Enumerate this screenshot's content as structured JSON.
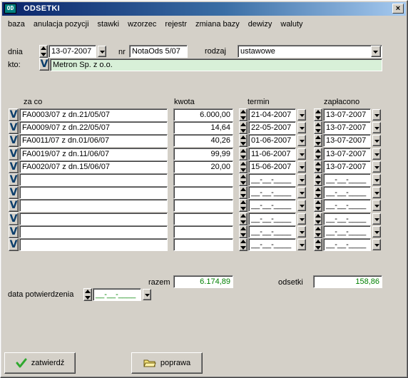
{
  "window": {
    "title": "ODSETKI",
    "icon_text": "OD"
  },
  "menu": [
    "baza",
    "anulacja pozycji",
    "stawki",
    "wzorzec",
    "rejestr",
    "zmiana bazy",
    "dewizy",
    "waluty"
  ],
  "header": {
    "dnia_label": "dnia",
    "dnia_value": "13-07-2007",
    "nr_label": "nr",
    "nr_value": "NotaOds 5/07",
    "rodzaj_label": "rodzaj",
    "rodzaj_value": "ustawowe",
    "kto_label": "kto:",
    "kto_value": "Metron Sp. z o.o."
  },
  "table": {
    "columns": {
      "za_co": "za co",
      "kwota": "kwota",
      "termin": "termin",
      "zaplacono": "zapłacono"
    },
    "rows": [
      {
        "za_co": "FA0003/07 z dn.21/05/07",
        "kwota": "6.000,00",
        "termin": "21-04-2007",
        "zaplacono": "13-07-2007"
      },
      {
        "za_co": "FA0009/07 z dn.22/05/07",
        "kwota": "14,64",
        "termin": "22-05-2007",
        "zaplacono": "13-07-2007"
      },
      {
        "za_co": "FA0011/07 z dn.01/06/07",
        "kwota": "40,26",
        "termin": "01-06-2007",
        "zaplacono": "13-07-2007"
      },
      {
        "za_co": "FA0019/07 z dn.11/06/07",
        "kwota": "99,99",
        "termin": "11-06-2007",
        "zaplacono": "13-07-2007"
      },
      {
        "za_co": "FA0020/07 z dn.15/06/07",
        "kwota": "20,00",
        "termin": "15-06-2007",
        "zaplacono": "13-07-2007"
      },
      {
        "za_co": "",
        "kwota": "",
        "termin": "__-__-____",
        "zaplacono": "__-__-____"
      },
      {
        "za_co": "",
        "kwota": "",
        "termin": "__-__-____",
        "zaplacono": "__-__-____"
      },
      {
        "za_co": "",
        "kwota": "",
        "termin": "__-__-____",
        "zaplacono": "__-__-____"
      },
      {
        "za_co": "",
        "kwota": "",
        "termin": "__-__-____",
        "zaplacono": "__-__-____"
      },
      {
        "za_co": "",
        "kwota": "",
        "termin": "__-__-____",
        "zaplacono": "__-__-____"
      },
      {
        "za_co": "",
        "kwota": "",
        "termin": "__-__-____",
        "zaplacono": "__-__-____"
      }
    ]
  },
  "totals": {
    "razem_label": "razem",
    "razem_value": "6.174,89",
    "odsetki_label": "odsetki",
    "odsetki_value": "158,86",
    "data_potwierdzenia_label": "data potwierdzenia",
    "data_potwierdzenia_value": "__-__-____"
  },
  "buttons": {
    "zatwierdz": "zatwierdź",
    "poprawa": "poprawa"
  },
  "icons": {
    "v_button": "V",
    "check": "check-icon",
    "folder": "folder-icon"
  },
  "colors": {
    "title_start": "#0a246a",
    "title_end": "#a6caf0",
    "kto_bg": "#d8f0d8",
    "total_text": "#008000",
    "check_green": "#2ea82e"
  }
}
